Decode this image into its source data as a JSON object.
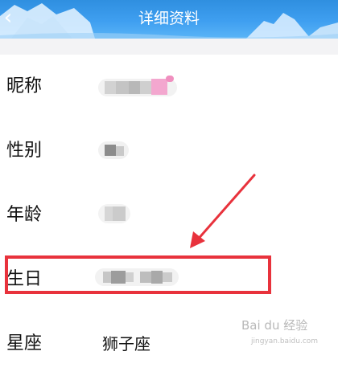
{
  "header": {
    "title": "详细资料",
    "back_icon": "chevron-left-icon",
    "background_color": "#3a9af0"
  },
  "profile": {
    "nickname_label": "昵称",
    "gender_label": "性别",
    "age_label": "年龄",
    "birthday_label": "生日",
    "zodiac_label": "星座",
    "zodiac_value": "狮子座"
  },
  "annotation": {
    "highlight_color": "#e8323c",
    "arrow_color": "#e8323c"
  },
  "watermark": {
    "text": "Bai du 经验",
    "url": "jingyan.baidu.com"
  }
}
